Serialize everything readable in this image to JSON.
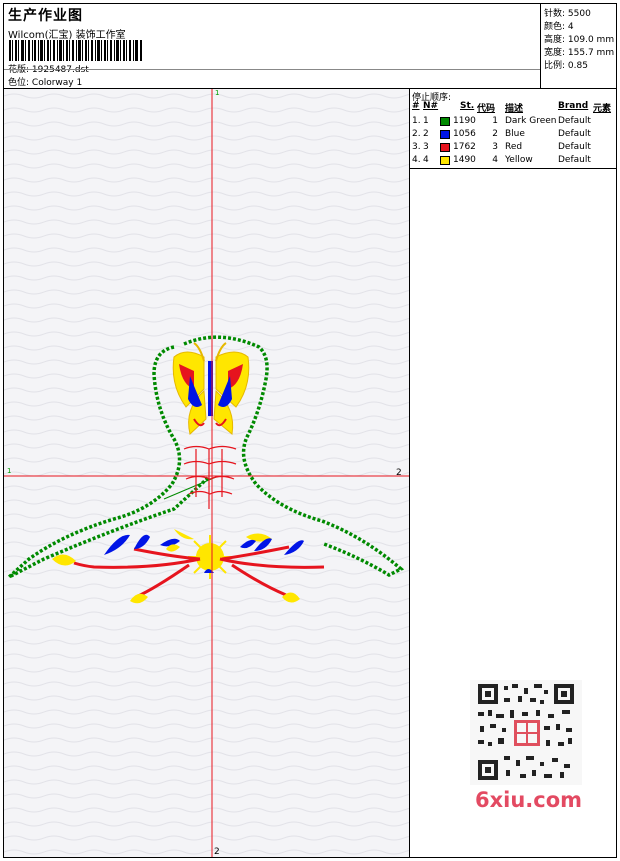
{
  "header": {
    "title": "生产作业图",
    "company": "Wilcom(汇宝) 装饰工作室",
    "design_label": "花版:",
    "design_value": "1925487.dst",
    "colorway_label": "色位:",
    "colorway_value": "Colorway 1"
  },
  "stats": [
    {
      "label": "针数:",
      "value": "5500"
    },
    {
      "label": "颜色:",
      "value": "4"
    },
    {
      "label": "高度:",
      "value": "109.0 mm"
    },
    {
      "label": "宽度:",
      "value": "155.7 mm"
    },
    {
      "label": "比例:",
      "value": "0.85"
    }
  ],
  "canvas": {
    "v_top": "1",
    "v_bottom": "2",
    "h_left": "1",
    "h_right": "2",
    "axis_color": "#e8141e"
  },
  "stop_sequence": {
    "label": "停止顺序:",
    "columns": [
      "#",
      "N#",
      "St.",
      "代码",
      "描述",
      "Brand",
      "元素"
    ],
    "rows": [
      {
        "n": "1.",
        "nn": "1",
        "swatch": "#008a00",
        "st": "1190",
        "code": "1",
        "desc": "Dark Green",
        "brand": "Default"
      },
      {
        "n": "2.",
        "nn": "2",
        "swatch": "#0014e6",
        "st": "1056",
        "code": "2",
        "desc": "Blue",
        "brand": "Default"
      },
      {
        "n": "3.",
        "nn": "3",
        "swatch": "#e6141e",
        "st": "1762",
        "code": "3",
        "desc": "Red",
        "brand": "Default"
      },
      {
        "n": "4.",
        "nn": "4",
        "swatch": "#ffe600",
        "st": "1490",
        "code": "4",
        "desc": "Yellow",
        "brand": "Default"
      }
    ]
  },
  "watermark": {
    "text": "6xiu.com"
  }
}
